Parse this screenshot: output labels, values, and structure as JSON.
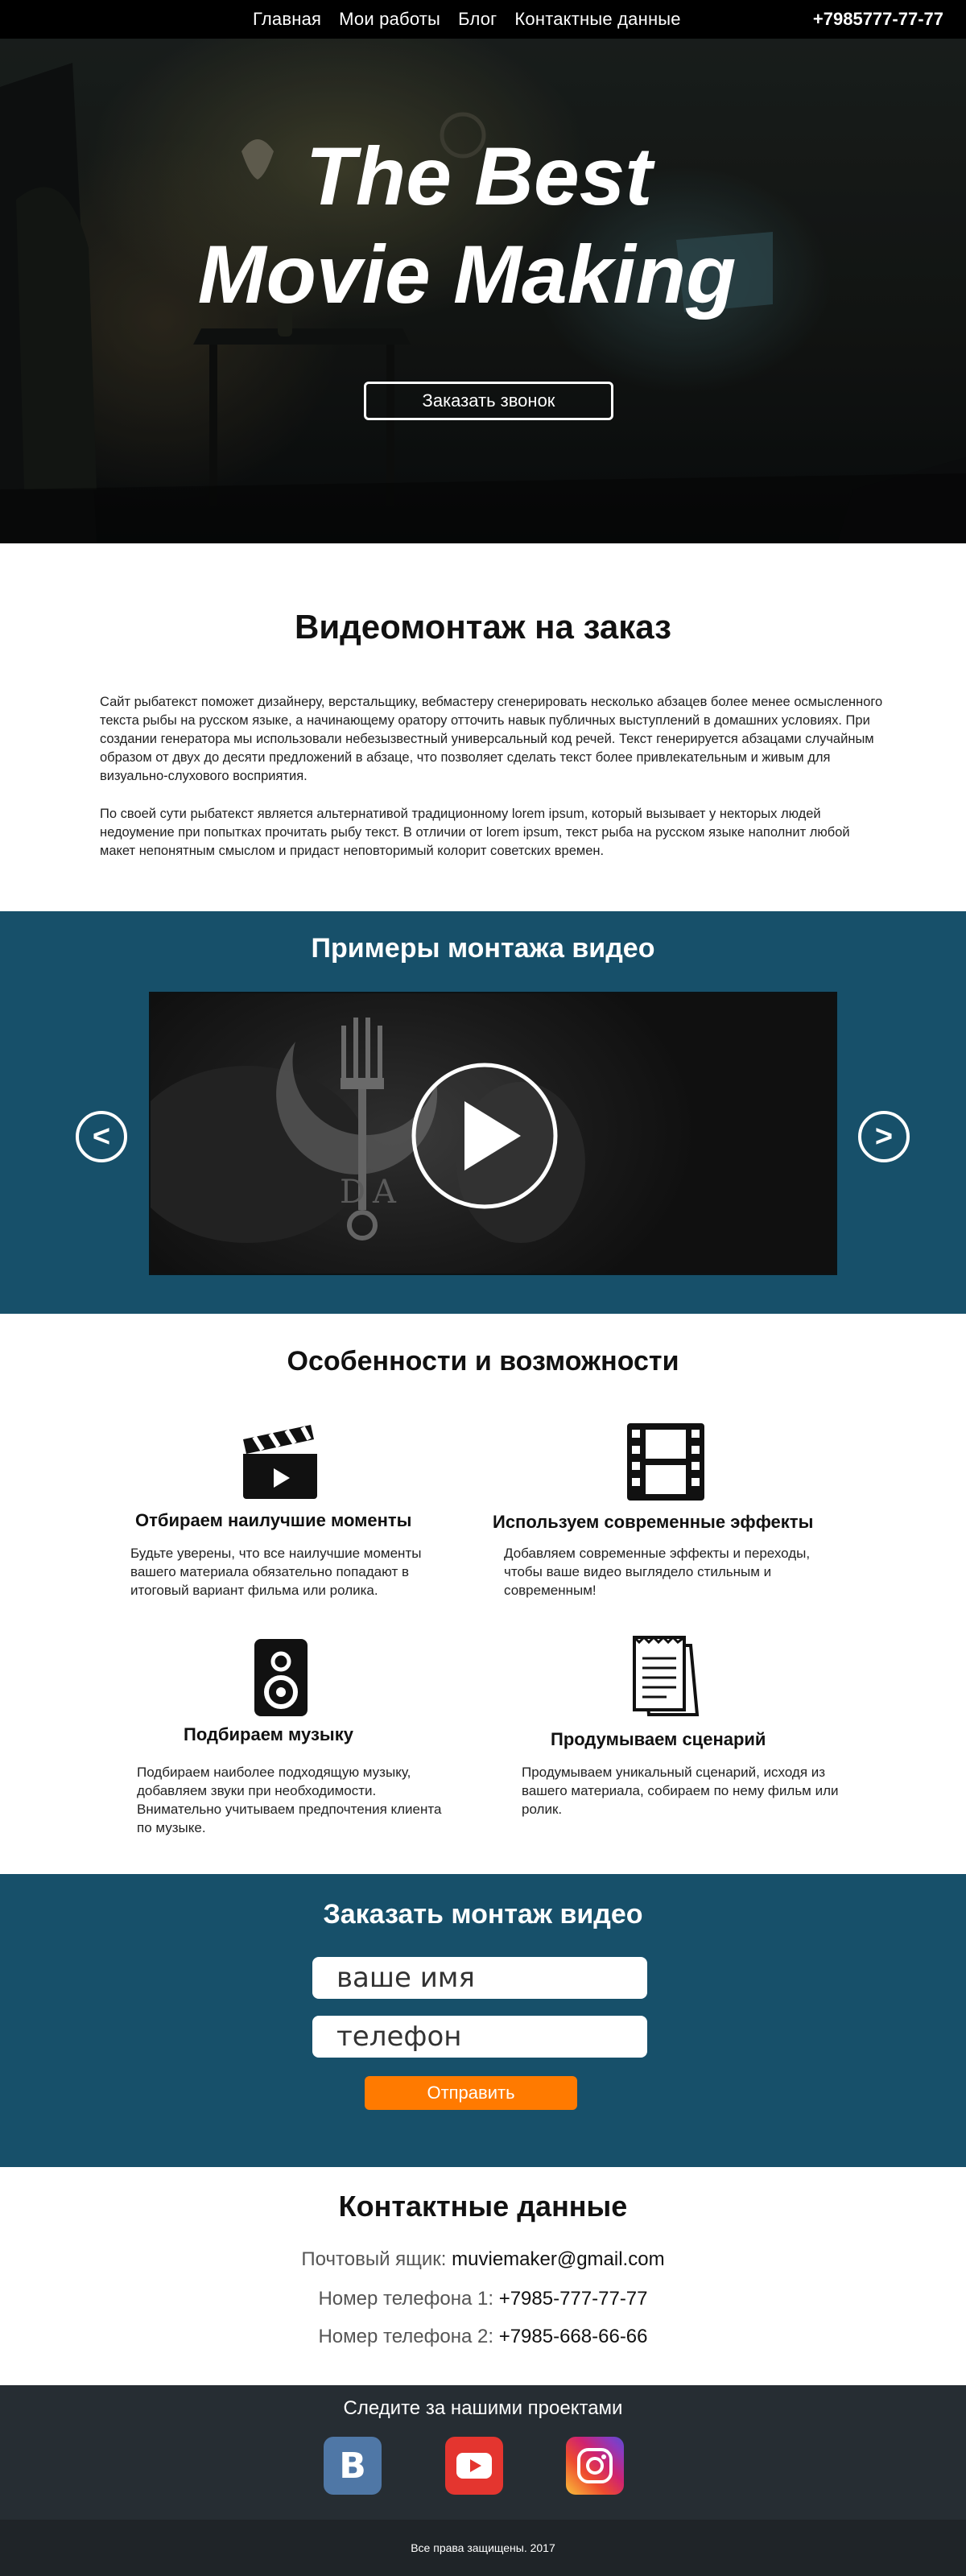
{
  "nav": {
    "links": [
      "Главная",
      "Мои работы",
      "Блог",
      "Контактные данные"
    ],
    "phone": "+7985777-77-77"
  },
  "hero": {
    "title_line1": "The Best",
    "title_line2": "Movie Making",
    "button": "Заказать звонок"
  },
  "intro": {
    "title": "Видеомонтаж на заказ",
    "paragraph1": "Сайт рыбатекст поможет дизайнеру, верстальщику, вебмастеру сгенерировать несколько абзацев более менее осмысленного текста рыбы на русском языке, а начинающему оратору отточить навык публичных выступлений в домашних условиях. При создании генератора мы использовали небезызвестный универсальный код речей. Текст генерируется абзацами случайным образом от двух до десяти предложений в абзаце, что позволяет сделать текст более привлекательным и живым для визуально-слухового восприятия.",
    "paragraph2": "По своей сути рыбатекст является альтернативой традиционному lorem ipsum, который вызывает у некторых людей недоумение при попытках прочитать рыбу текст. В отличии от lorem ipsum, текст рыба на русском языке наполнит любой макет непонятным смыслом и придаст неповторимый колорит советских времен."
  },
  "examples": {
    "title": "Примеры монтажа видео",
    "prev_arrow": "<",
    "next_arrow": ">"
  },
  "features": {
    "title": "Особенности и возможности",
    "items": [
      {
        "icon": "clapperboard-icon",
        "heading": "Отбираем наилучшие моменты",
        "text": "Будьте уверены, что все наилучшие моменты вашего материала обязательно попадают в итоговый вариант фильма или ролика."
      },
      {
        "icon": "film-strip-icon",
        "heading": "Используем современные эффекты",
        "text": "Добавляем современные эффекты и переходы, чтобы ваше видео выглядело стильным и современным!"
      },
      {
        "icon": "speaker-icon",
        "heading": "Подбираем музыку",
        "text": "Подбираем наиболее подходящую музыку, добавляем звуки при необходимости. Внимательно учитываем предпочтения клиента по музыке."
      },
      {
        "icon": "script-document-icon",
        "heading": "Продумываем сценарий",
        "text": "Продумываем уникальный сценарий, исходя из вашего материала, собираем по нему фильм или ролик."
      }
    ]
  },
  "order_form": {
    "title": "Заказать монтаж видео",
    "name_placeholder": "ваше имя",
    "phone_placeholder": "телефон",
    "submit": "Отправить"
  },
  "contacts": {
    "title": "Контактные данные",
    "email_label": "Почтовый ящик:",
    "email_value": "muviemaker@gmail.com",
    "phone1_label": "Номер телефона 1:",
    "phone1_value": "+7985-777-77-77",
    "phone2_label": "Номер телефона 2:",
    "phone2_value": "+7985-668-66-66"
  },
  "follow": {
    "title": "Следите за нашими проектами",
    "vk_letter": "B",
    "networks": [
      "vk-icon",
      "youtube-icon",
      "instagram-icon"
    ]
  },
  "footer": {
    "text": "Все права защищены. 2017"
  },
  "colors": {
    "section_blue": "#17506a",
    "accent_orange": "#ff7a00",
    "follow_bg": "#262d33",
    "footer_bg": "#1f2428",
    "vk": "#4f77a6",
    "youtube": "#e4352f"
  }
}
